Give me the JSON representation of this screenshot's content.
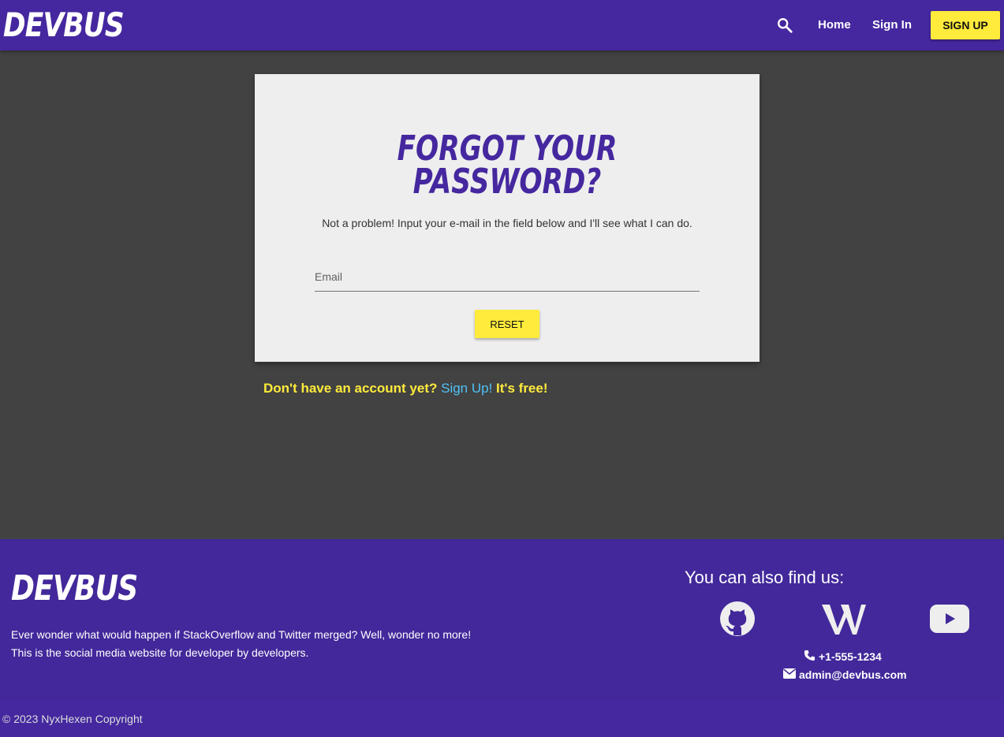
{
  "nav": {
    "brand": "DEVBUS",
    "home": "Home",
    "sign_in": "Sign In",
    "sign_up": "SIGN UP",
    "search_icon": "search-icon"
  },
  "card": {
    "title": "Forgot your password?",
    "text": "Not a problem! Input your e-mail in the field below and I'll see what I can do.",
    "email_placeholder": "Email",
    "reset_label": "RESET"
  },
  "signup_hint": {
    "prefix": "Don't have an account yet?",
    "link": "Sign Up!",
    "suffix": "It's free!"
  },
  "footer": {
    "brand": "DEVBUS",
    "description": "Ever wonder what would happen if StackOverflow and Twitter merged? Well, wonder no more! This is the social media website for developer by developers.",
    "find_us": "You can also find us:",
    "socials": [
      "github-icon",
      "wikipedia-icon",
      "youtube-icon"
    ],
    "phone": "+1-555-1234",
    "email": "admin@devbus.com",
    "copyright": "© 2023 NyxHexen Copyright"
  },
  "colors": {
    "brand_purple": "#45289f",
    "accent_yellow": "#ffeb3b",
    "link_blue": "#4fc3f7",
    "background": "#424242"
  }
}
